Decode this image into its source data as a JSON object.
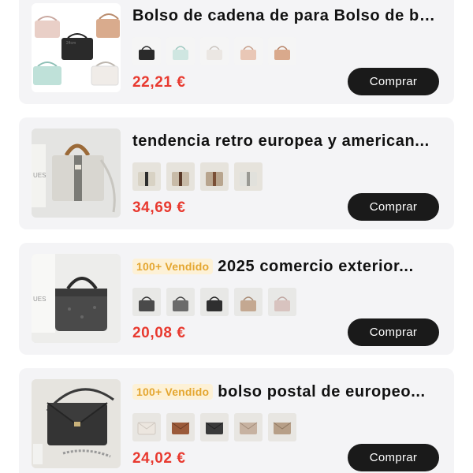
{
  "products": [
    {
      "title": "Bolso de cadena de para Bolso de bo...",
      "badge": "",
      "price": "22,21 €",
      "buy_label": "Comprar",
      "thumb_label": "24cm",
      "variant_colors": [
        "#2a2a2a",
        "#cfe6e1",
        "#ebe7e3",
        "#e9c7b6",
        "#d9a98c"
      ]
    },
    {
      "title": "tendencia retro europea y american...",
      "badge": "",
      "price": "34,69 €",
      "buy_label": "Comprar",
      "thumb_label": "UES",
      "variant_colors": [
        "#d8d2c4",
        "#c8bba8",
        "#b8a58e",
        "#e1e1dc"
      ]
    },
    {
      "title": "2025 comercio exterior...",
      "badge": "100+ Vendido",
      "price": "20,08 €",
      "buy_label": "Comprar",
      "thumb_label": "UES",
      "variant_colors": [
        "#4a4a4a",
        "#6b6b6b",
        "#2f2f2f",
        "#c4a891",
        "#d8c3bf"
      ]
    },
    {
      "title": "bolso postal de europeo...",
      "badge": "100+ Vendido",
      "price": "24,02 €",
      "buy_label": "Comprar",
      "thumb_label": "",
      "variant_colors": [
        "#ece6df",
        "#9b5a3a",
        "#3a3a3a",
        "#c7b2a1",
        "#b79f88"
      ]
    }
  ]
}
